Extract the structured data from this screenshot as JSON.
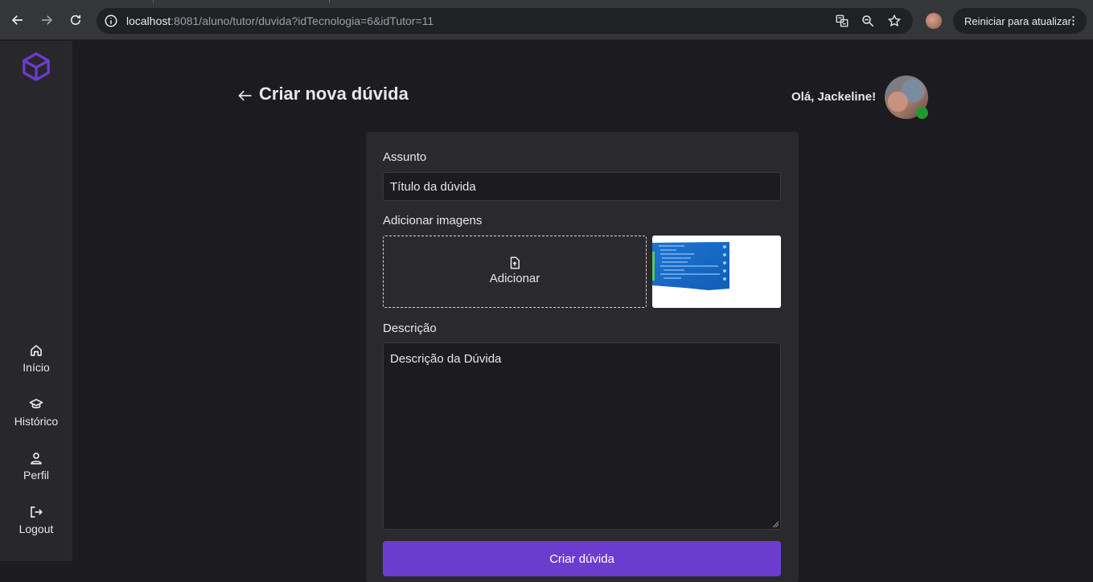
{
  "browser": {
    "url_host": "localhost",
    "url_rest": ":8081/aluno/tutor/duvida?idTecnologia=6&idTutor=11",
    "update_label": "Reiniciar para atualizar",
    "icons": [
      "back-icon",
      "forward-icon",
      "reload-icon",
      "info-icon",
      "translate-icon",
      "zoom-icon",
      "star-icon",
      "kebab-icon"
    ]
  },
  "sidebar": {
    "logo": "box-logo-icon",
    "items": [
      {
        "label": "Início",
        "icon": "home-icon"
      },
      {
        "label": "Histórico",
        "icon": "graduation-cap-icon"
      },
      {
        "label": "Perfil",
        "icon": "user-icon"
      },
      {
        "label": "Logout",
        "icon": "logout-icon"
      }
    ]
  },
  "header": {
    "title": "Criar nova dúvida",
    "greeting": "Olá, Jackeline!"
  },
  "form": {
    "subject_label": "Assunto",
    "subject_value": "Título da dúvida",
    "images_label": "Adicionar imagens",
    "add_label": "Adicionar",
    "description_label": "Descrição",
    "description_value": "Descrição da Dúvida",
    "submit_label": "Criar dúvida"
  },
  "colors": {
    "accent": "#6c3ccf",
    "online": "#1f9a2e",
    "background": "#1c1b1f",
    "sidebar": "#28272b",
    "card": "#2a292d"
  }
}
